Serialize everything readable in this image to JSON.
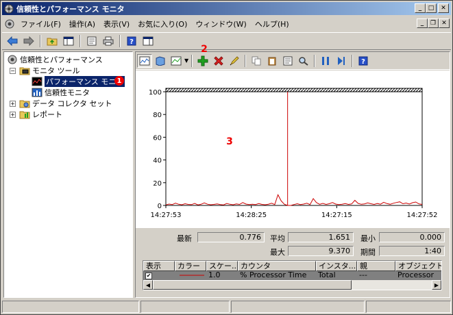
{
  "window": {
    "title": "信頼性とパフォーマンス モニタ"
  },
  "menu": [
    "ファイル(F)",
    "操作(A)",
    "表示(V)",
    "お気に入り(O)",
    "ウィンドウ(W)",
    "ヘルプ(H)"
  ],
  "tree": {
    "root": "信頼性とパフォーマンス",
    "monitor_tools": "モニタ ツール",
    "performance_monitor": "パフォーマンス モニタ",
    "reliability_monitor": "信頼性モニタ",
    "data_collector_sets": "データ コレクタ セット",
    "reports": "レポート"
  },
  "badges": {
    "one": "1",
    "two": "2",
    "three": "3"
  },
  "chart_data": {
    "type": "line",
    "ylim": [
      0,
      100
    ],
    "yticks": [
      "100",
      "80",
      "60",
      "40",
      "20",
      "0"
    ],
    "xticks": [
      "14:27:53",
      "14:28:25",
      "14:27:15",
      "14:27:52"
    ],
    "series": [
      {
        "color": "#cc0000",
        "values": [
          0.5,
          1.2,
          0.8,
          2.0,
          1.0,
          0.6,
          1.5,
          0.9,
          0.7,
          1.8,
          0.5,
          1.0,
          2.2,
          1.1,
          0.6,
          0.9,
          1.4,
          0.8,
          0.5,
          1.7,
          1.0,
          0.6,
          1.3,
          0.9,
          2.5,
          1.2,
          0.7,
          1.0,
          0.8,
          1.6,
          0.9,
          0.6,
          1.1,
          1.9,
          0.8,
          9.37,
          4.0,
          1.0,
          0.0,
          0.0,
          0.776,
          1.5,
          0.8,
          1.2,
          1.9,
          0.8,
          6.0,
          2.5,
          1.0,
          1.8,
          0.9,
          1.5,
          2.5,
          1.2,
          0.8,
          1.1,
          1.6,
          0.9,
          1.3,
          4.5,
          1.8,
          1.0,
          1.4,
          2.2,
          1.5,
          0.9,
          1.7,
          1.1,
          2.8,
          1.6,
          1.0,
          1.9,
          2.6,
          3.2,
          1.5,
          2.1,
          1.2,
          2.4,
          3.0,
          1.3,
          0.9
        ]
      }
    ],
    "cursor_index": 38
  },
  "stats": {
    "latest_label": "最新",
    "latest": "0.776",
    "average_label": "平均",
    "average": "1.651",
    "min_label": "最小",
    "min": "0.000",
    "max_label": "最大",
    "max": "9.370",
    "duration_label": "期間",
    "duration": "1:40"
  },
  "table": {
    "headers": [
      "表示",
      "カラー",
      "スケー...",
      "カウンタ",
      "インスタ...",
      "親",
      "オブジェクト"
    ],
    "row": {
      "show": "✔",
      "scale": "1.0",
      "counter": "% Processor Time",
      "instance": "Total",
      "parent": "---",
      "object": "Processor"
    }
  }
}
